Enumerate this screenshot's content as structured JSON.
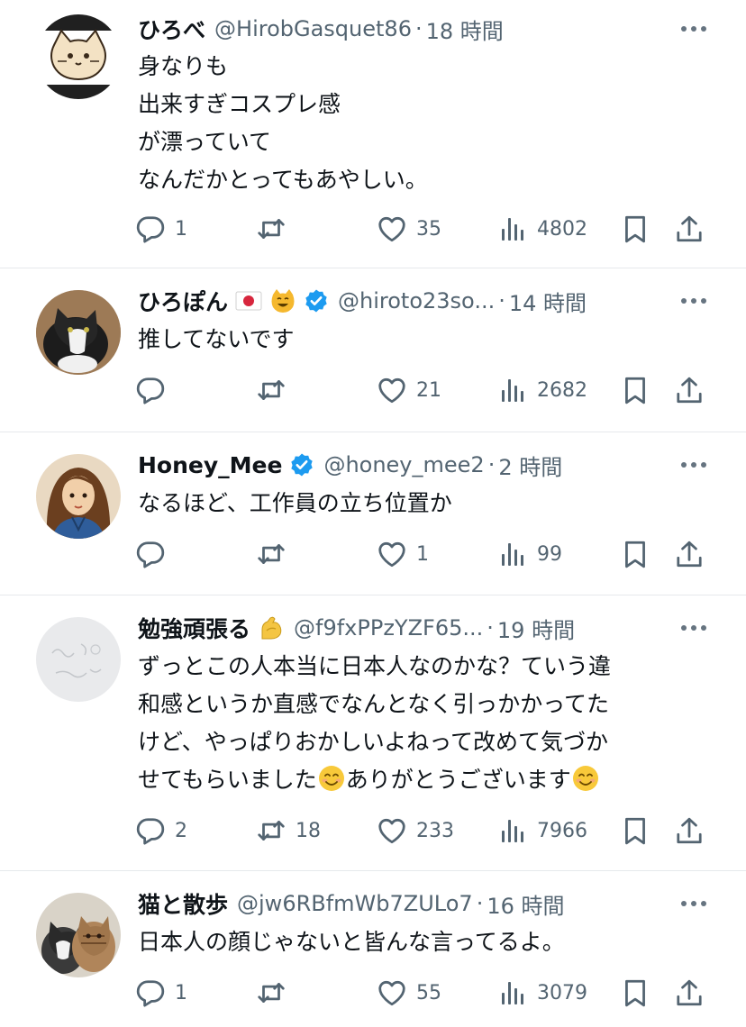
{
  "tweets": [
    {
      "name": "ひろべ",
      "handle": "@HirobGasquet86",
      "dot": "·",
      "time": "18 時間",
      "text": [
        "身なりも",
        "出来すぎコスプレ感",
        "が漂っていて",
        "なんだかとってもあやしい。"
      ],
      "counts": {
        "reply": "1",
        "retweet": "",
        "like": "35",
        "views": "4802"
      }
    },
    {
      "name": "ひろぽん",
      "name_emojis": [
        "japan-flag-emoji",
        "cat-face-emoji"
      ],
      "verified": true,
      "handle": "@hiroto23so...",
      "dot": "·",
      "time": "14 時間",
      "text": [
        "推してないです"
      ],
      "counts": {
        "reply": "",
        "retweet": "",
        "like": "21",
        "views": "2682"
      }
    },
    {
      "name": "Honey_Mee",
      "verified": true,
      "handle": "@honey_mee2",
      "dot": "·",
      "time": "2 時間",
      "text": [
        "なるほど、工作員の立ち位置か"
      ],
      "counts": {
        "reply": "",
        "retweet": "",
        "like": "1",
        "views": "99"
      }
    },
    {
      "name": "勉強頑張る",
      "name_emojis": [
        "flexed-biceps-emoji"
      ],
      "handle": "@f9fxPPzYZF65...",
      "dot": "·",
      "time": "19 時間",
      "text": [
        "ずっとこの人本当に日本人なのかな？ていう違",
        "和感というか直感でなんとなく引っかかってた",
        "けど、やっぱりおかしいよねって改めて気づか"
      ],
      "text_last_a": "せてもらいました",
      "text_last_b": "ありがとうございます",
      "counts": {
        "reply": "2",
        "retweet": "18",
        "like": "233",
        "views": "7966"
      }
    },
    {
      "name": "猫と散歩",
      "handle": "@jw6RBfmWb7ZULo7",
      "dot": "·",
      "time": "16 時間",
      "text": [
        "日本人の顔じゃないと皆んな言ってるよ。"
      ],
      "counts": {
        "reply": "1",
        "retweet": "",
        "like": "55",
        "views": "3079"
      }
    }
  ],
  "icons": {
    "reply": "reply-icon",
    "retweet": "retweet-icon",
    "like": "heart-icon",
    "views": "views-icon",
    "bookmark": "bookmark-icon",
    "share": "share-icon",
    "more": "more-icon",
    "verified": "verified-badge-icon"
  },
  "colors": {
    "text": "#0f1419",
    "secondary": "#536471",
    "verified": "#1d9bf0",
    "divider": "#e6e9ec"
  }
}
